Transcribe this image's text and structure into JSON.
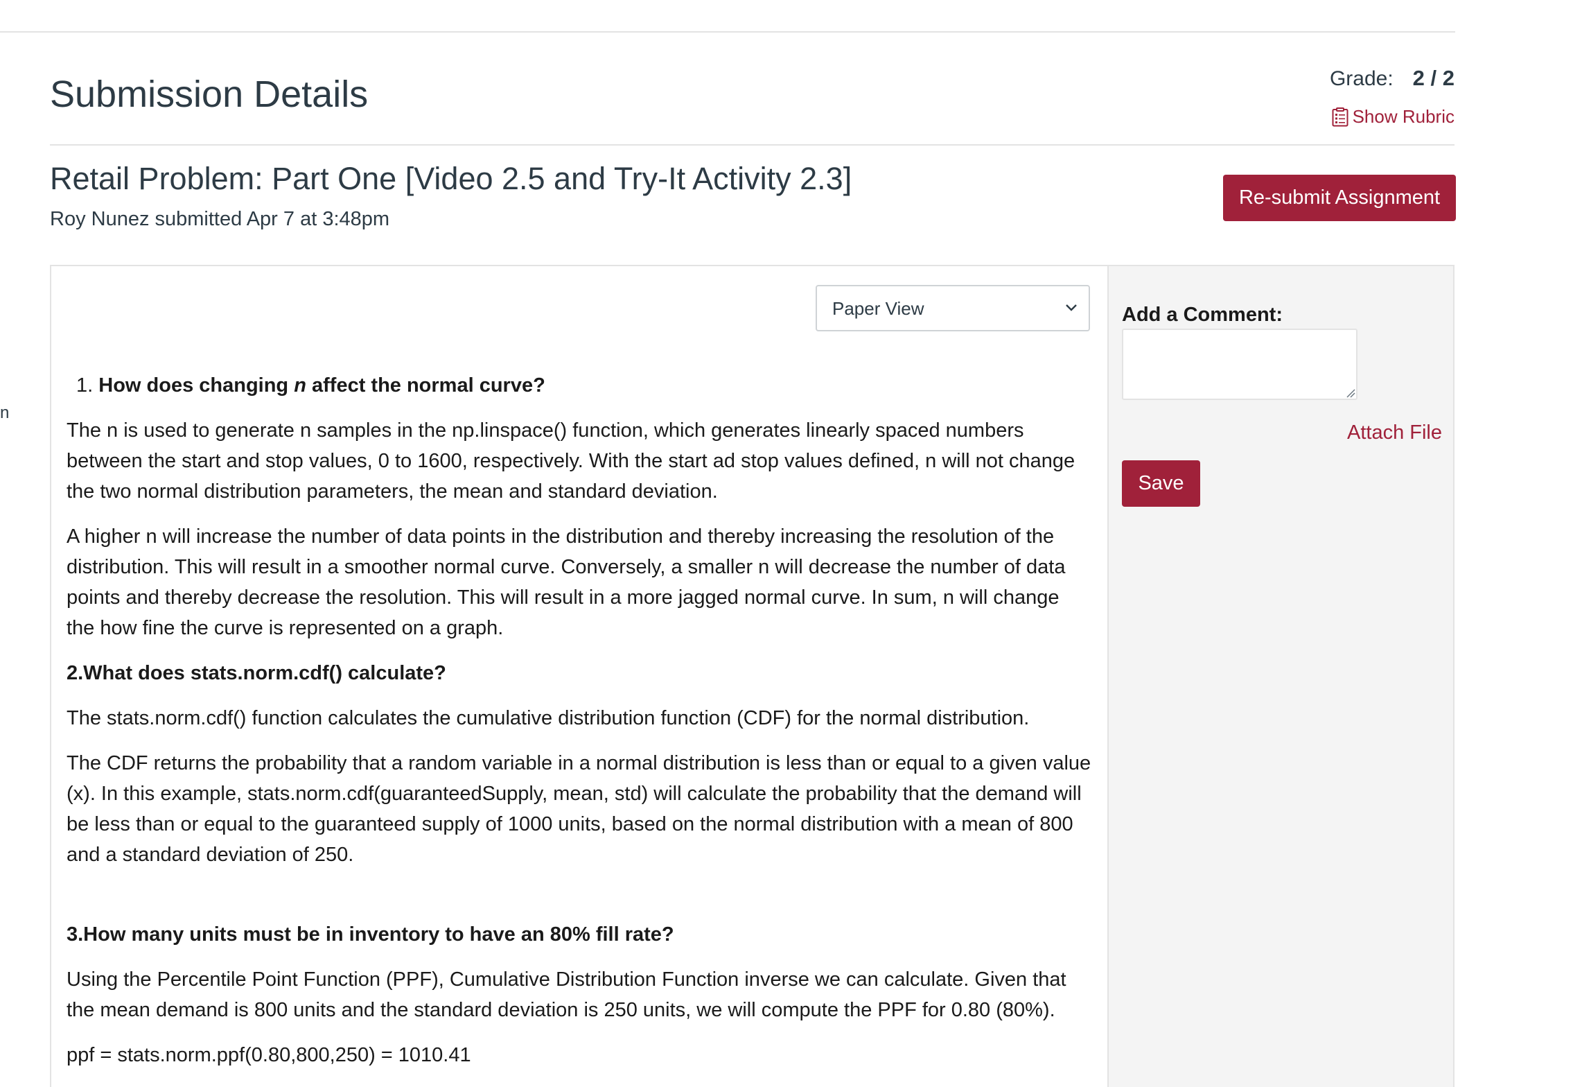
{
  "header": {
    "page_title": "Submission Details",
    "grade_label": "Grade:",
    "grade_value": "2 / 2",
    "show_rubric": "Show Rubric"
  },
  "assignment": {
    "title": "Retail Problem: Part One [Video 2.5 and Try-It Activity 2.3]",
    "submitted_line": "Roy Nunez submitted Apr 7 at 3:48pm",
    "resubmit_label": "Re-submit Assignment"
  },
  "stray_text": "n",
  "viewer": {
    "selected_view": "Paper View"
  },
  "document": {
    "q1_number": "1.",
    "q1_pre": "How does changing ",
    "q1_var": "n",
    "q1_post": " affect the normal curve?",
    "q1_p1": "The n is used to generate n samples in the np.linspace() function, which generates linearly spaced numbers between the start and stop values, 0 to 1600, respectively. With the start ad stop values defined, n will not change the two normal distribution parameters, the mean and standard deviation.",
    "q1_p2": "A higher n will increase the number of data points in the distribution and thereby  increasing the resolution of the distribution. This will result in a smoother normal curve. Conversely, a smaller n will decrease the number of data points and thereby decrease the resolution. This will result in a more jagged normal curve. In sum, n will change the how fine the curve is represented on a graph.",
    "q2_heading": "2.What does stats.norm.cdf() calculate?",
    "q2_p1": "The stats.norm.cdf() function calculates the cumulative distribution function (CDF) for the normal distribution.",
    "q2_p2": "The CDF returns the probability that a random variable in a normal distribution is less than or equal to a given value (x). In this example, stats.norm.cdf(guaranteedSupply, mean, std) will calculate the probability that the demand will be less than or equal to the guaranteed supply of 1000 units, based on the normal distribution with a mean of 800 and a standard deviation of 250.",
    "q3_heading": "3.How many units must be in inventory to have an 80% fill rate?",
    "q3_p1": "Using the Percentile Point Function (PPF), Cumulative Distribution Function inverse we can calculate. Given that the mean demand is 800 units and the standard deviation is 250 units, we will compute the PPF for 0.80 (80%).",
    "q3_p2": "ppf = stats.norm.ppf(0.80,800,250) = 1010.41"
  },
  "comments": {
    "label": "Add a Comment:",
    "value": "",
    "attach_label": "Attach File",
    "save_label": "Save"
  },
  "colors": {
    "brand": "#a0213a",
    "text": "#2d3b45",
    "sidebar_bg": "#f4f4f4",
    "rule": "#e3e3e3"
  },
  "icons": {
    "rubric": "rubric-icon",
    "dropdown": "chevron-down-icon",
    "resize": "resize-handle-icon"
  }
}
